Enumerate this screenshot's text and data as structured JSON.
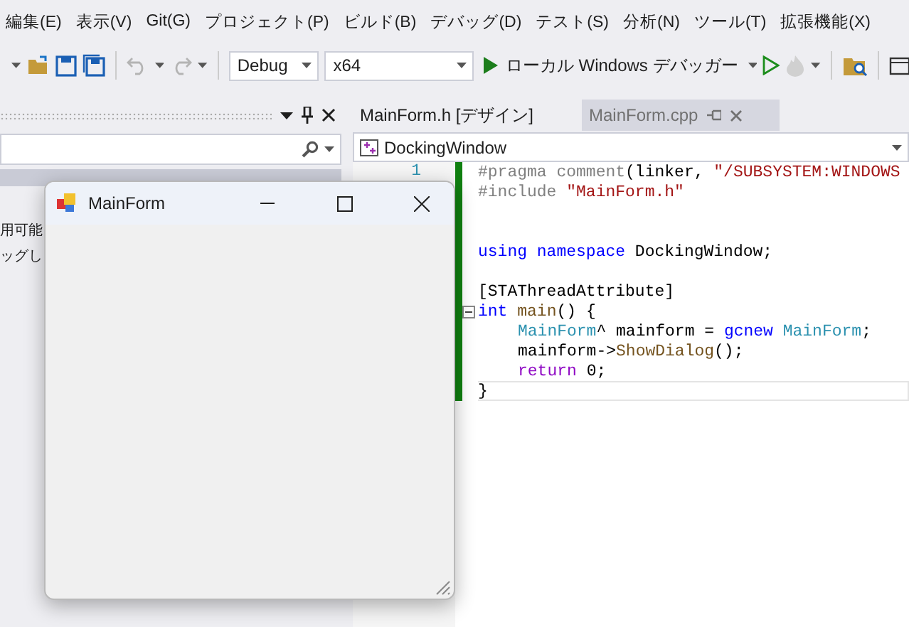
{
  "menu": [
    "編集(E)",
    "表示(V)",
    "Git(G)",
    "プロジェクト(P)",
    "ビルド(B)",
    "デバッグ(D)",
    "テスト(S)",
    "分析(N)",
    "ツール(T)",
    "拡張機能(X)"
  ],
  "toolbar": {
    "configuration": "Debug",
    "platform": "x64",
    "run_label": "ローカル Windows デバッガー",
    "undo_disabled": true,
    "hot_reload_disabled": true
  },
  "left_panel": {
    "texts": [
      "用可能",
      "ッグし"
    ]
  },
  "editor": {
    "tabs": [
      {
        "label": "MainForm.h [デザイン]",
        "selected": false
      },
      {
        "label": "MainForm.cpp",
        "selected": true
      }
    ],
    "scope": "DockingWindow",
    "line_numbers": [
      "1"
    ],
    "lines": [
      {
        "kind": "code",
        "tokens": [
          {
            "kind": "pre",
            "text": "#pragma comment"
          },
          {
            "kind": "plain",
            "text": "(linker, "
          },
          {
            "kind": "str",
            "text": "\"/SUBSYSTEM:WINDOWS"
          }
        ]
      },
      {
        "kind": "code",
        "tokens": [
          {
            "kind": "pre",
            "text": "#include "
          },
          {
            "kind": "str",
            "text": "\"MainForm.h\""
          }
        ]
      },
      {
        "kind": "blank"
      },
      {
        "kind": "blank"
      },
      {
        "kind": "code",
        "tokens": [
          {
            "kind": "kw",
            "text": "using namespace"
          },
          {
            "kind": "plain",
            "text": " DockingWindow;"
          }
        ]
      },
      {
        "kind": "blank"
      },
      {
        "kind": "code",
        "tokens": [
          {
            "kind": "plain",
            "text": "[STAThreadAttribute]"
          }
        ]
      },
      {
        "kind": "code",
        "expanded": true,
        "tokens": [
          {
            "kind": "kw",
            "text": "int"
          },
          {
            "kind": "fn",
            "text": " main"
          },
          {
            "kind": "plain",
            "text": "() {"
          }
        ],
        "children": [
          {
            "kind": "code",
            "tokens": [
              {
                "kind": "type",
                "text": "MainForm"
              },
              {
                "kind": "plain",
                "text": "^ mainform = "
              },
              {
                "kind": "kw",
                "text": "gcnew"
              },
              {
                "kind": "type",
                "text": " MainForm"
              },
              {
                "kind": "plain",
                "text": ";"
              }
            ]
          },
          {
            "kind": "code",
            "tokens": [
              {
                "kind": "plain",
                "text": "mainform->"
              },
              {
                "kind": "fn",
                "text": "ShowDialog"
              },
              {
                "kind": "plain",
                "text": "();"
              }
            ]
          },
          {
            "kind": "code",
            "tokens": [
              {
                "kind": "ctl",
                "text": "return"
              },
              {
                "kind": "plain",
                "text": " 0;"
              }
            ]
          }
        ]
      },
      {
        "kind": "code",
        "current": true,
        "tokens": [
          {
            "kind": "plain",
            "text": "}"
          }
        ]
      }
    ]
  },
  "form_window": {
    "title": "MainForm"
  }
}
